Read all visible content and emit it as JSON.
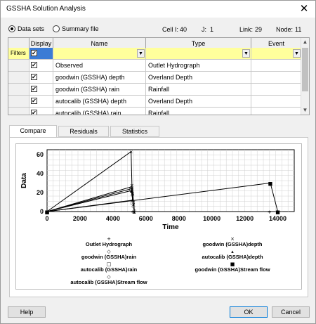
{
  "window": {
    "title": "GSSHA Solution Analysis"
  },
  "mode": {
    "data_sets_label": "Data sets",
    "summary_file_label": "Summary file",
    "selected": "Data sets"
  },
  "info": {
    "cell_label": "Cell  I:",
    "cell_value": "40",
    "j_label": "J:",
    "j_value": "1",
    "link_label": "Link:",
    "link_value": "29",
    "node_label": "Node:",
    "node_value": "11"
  },
  "grid": {
    "columns": [
      "Display",
      "Name",
      "Type",
      "Event"
    ],
    "filter_label": "Filters",
    "rows": [
      {
        "display": true,
        "name": "Observed",
        "type": "Outlet Hydrograph",
        "event": ""
      },
      {
        "display": true,
        "name": "goodwin (GSSHA) depth",
        "type": "Overland Depth",
        "event": ""
      },
      {
        "display": true,
        "name": "goodwin (GSSHA) rain",
        "type": "Rainfall",
        "event": ""
      },
      {
        "display": true,
        "name": "autocalib (GSSHA) depth",
        "type": "Overland Depth",
        "event": ""
      },
      {
        "display": true,
        "name": "autocalib (GSSHA) rain",
        "type": "Rainfall",
        "event": ""
      }
    ]
  },
  "tabs": [
    {
      "label": "Compare",
      "active": true
    },
    {
      "label": "Residuals",
      "active": false
    },
    {
      "label": "Statistics",
      "active": false
    }
  ],
  "chart_data": {
    "type": "scatter",
    "xlabel": "Time",
    "ylabel": "Data",
    "xlim": [
      0,
      15000
    ],
    "ylim": [
      0,
      65
    ],
    "xticks": [
      0,
      2000,
      4000,
      6000,
      8000,
      10000,
      12000,
      14000
    ],
    "yticks": [
      0,
      20,
      40,
      60
    ],
    "grid": true,
    "legend_position": "bottom",
    "series": [
      {
        "name": "Outlet Hydrograph",
        "marker": "+",
        "x": [
          0,
          5200,
          13500
        ],
        "y": [
          0,
          0,
          0
        ]
      },
      {
        "name": "goodwin (GSSHA)depth",
        "marker": "×",
        "x": [
          0,
          5100,
          5150,
          5200,
          5250,
          5300
        ],
        "y": [
          0,
          63,
          28,
          20,
          8,
          0
        ]
      },
      {
        "name": "goodwin (GSSHA)rain",
        "marker": "◇",
        "x": [
          0,
          5120,
          5180,
          5240
        ],
        "y": [
          0,
          26,
          18,
          6
        ]
      },
      {
        "name": "autocalib (GSSHA)depth",
        "marker": "▴",
        "x": [
          0,
          5100,
          5200,
          5300
        ],
        "y": [
          0,
          22,
          14,
          0
        ]
      },
      {
        "name": "autocalib (GSSHA)rain",
        "marker": "□",
        "x": [
          0,
          5120,
          5200
        ],
        "y": [
          0,
          24,
          10
        ]
      },
      {
        "name": "goodwin (GSSHA)Stream flow",
        "marker": "■",
        "x": [
          0,
          13550,
          14000
        ],
        "y": [
          0,
          30,
          0
        ]
      },
      {
        "name": "autocalib (GSSHA)Stream flow",
        "marker": "◇",
        "x": [
          0,
          5200,
          5300
        ],
        "y": [
          0,
          12,
          2
        ]
      }
    ]
  },
  "buttons": {
    "help": "Help",
    "ok": "OK",
    "cancel": "Cancel"
  },
  "icons": {
    "close": "close-icon"
  }
}
